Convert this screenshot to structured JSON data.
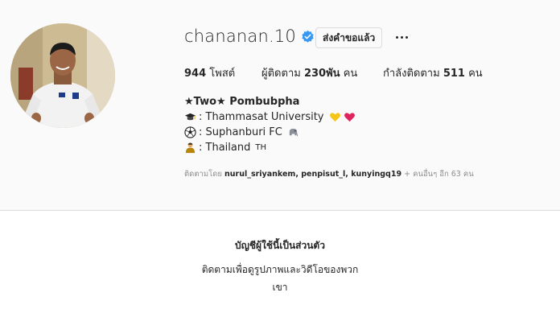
{
  "profile": {
    "username": "chananan.10",
    "request_button": "ส่งคำขอแล้ว",
    "stats": {
      "posts_count": "944",
      "posts_label": "โพสต์",
      "followers_label": "ผู้ติดตาม",
      "followers_count": "230พัน",
      "followers_unit": "คน",
      "following_label": "กำลังติดตาม",
      "following_count": "511",
      "following_unit": "คน"
    },
    "bio": {
      "name": "★Two★ Pombubpha",
      "university": ": Thammasat University",
      "club": ": Suphanburi FC",
      "country": ": Thailand",
      "country_code": "TH"
    },
    "followed_by": {
      "prefix": "ติดตามโดย",
      "names": "nurul_sriyankem, penpisut_l, kunyingq19",
      "suffix": "+ คนอื่นๆ อีก 63 คน"
    }
  },
  "private_notice": {
    "title": "บัญชีผู้ใช้นี้เป็นส่วนตัว",
    "line1": "ติดตามเพื่อดูรูปภาพและวิดีโอของพวก",
    "line2": "เขา"
  },
  "icons": {
    "verified": "verified-badge-icon",
    "more": "more-options-icon",
    "graduation_cap": "graduation-cap-icon",
    "yellow_heart": "yellow-heart-icon",
    "red_heart": "red-heart-icon",
    "soccer_ball": "soccer-ball-icon",
    "elephant": "elephant-icon",
    "person_praying": "person-icon"
  },
  "colors": {
    "verified_blue": "#3897f0",
    "muted_text": "#8e8e8e",
    "border": "#dbdbdb"
  }
}
